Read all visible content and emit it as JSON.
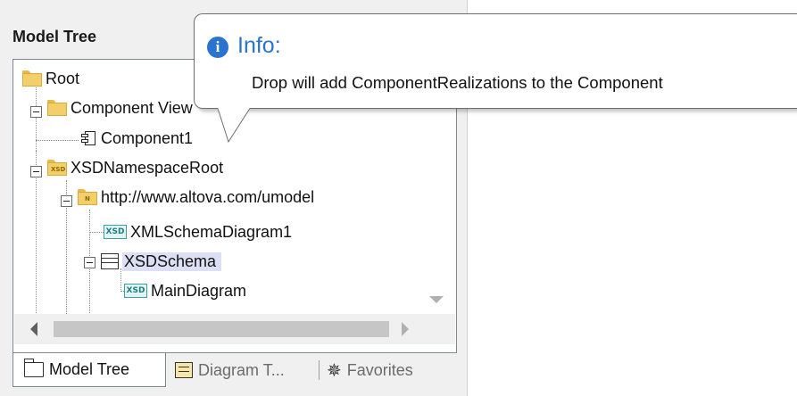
{
  "panel": {
    "title": "Model Tree"
  },
  "tree": [
    {
      "label": "Root",
      "icon": "folder-icon"
    },
    {
      "label": "Component View",
      "icon": "folder-icon"
    },
    {
      "label": "Component1",
      "icon": "component-icon"
    },
    {
      "label": "XSDNamespaceRoot",
      "icon": "xsd-folder-icon"
    },
    {
      "label": "http://www.altova.com/umodel",
      "icon": "namespace-folder-icon"
    },
    {
      "label": "XMLSchemaDiagram1",
      "icon": "xsd-diagram-icon"
    },
    {
      "label": "XSDSchema",
      "icon": "schema-icon",
      "selected": true
    },
    {
      "label": "MainDiagram",
      "icon": "xsd-diagram-icon"
    }
  ],
  "icons": {
    "xsd_badge": "XSD",
    "ns_badge": "N"
  },
  "tabs": [
    {
      "label": "Model Tree",
      "active": true
    },
    {
      "label": "Diagram T...",
      "active": false
    },
    {
      "label": "Favorites",
      "active": false
    }
  ],
  "callout": {
    "title": "Info:",
    "icon_glyph": "i",
    "message": "Drop will add ComponentRealizations to the Component"
  },
  "colors": {
    "accent": "#2a74cf",
    "selection": "#dde0f5",
    "folder": "#f3cf6a",
    "xsd": "#3aa0a0"
  }
}
